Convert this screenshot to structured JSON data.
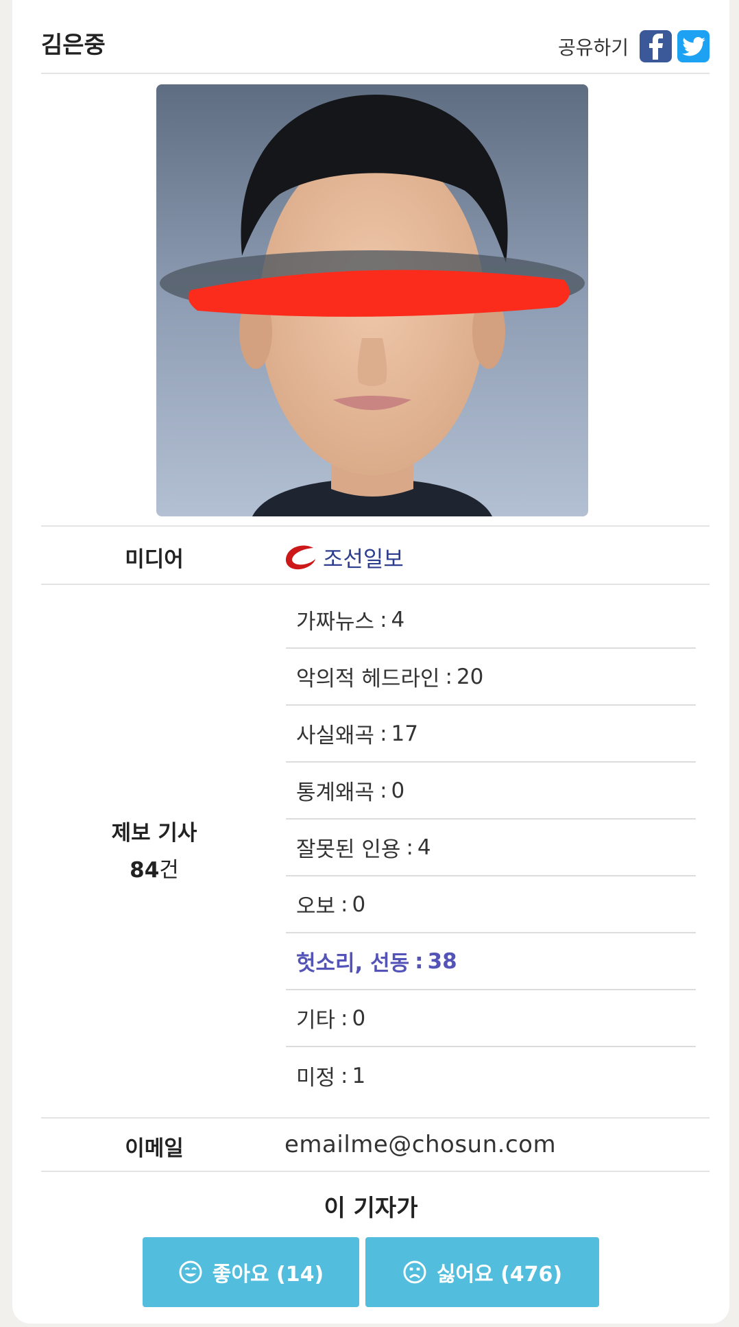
{
  "reporter": {
    "name": "김은중"
  },
  "share": {
    "label": "공유하기"
  },
  "media": {
    "label": "미디어",
    "name": "조선일보"
  },
  "reports": {
    "label": "제보 기사",
    "count": "84",
    "unit": "건",
    "items": [
      {
        "name": "가짜뉴스",
        "value": "4"
      },
      {
        "name": "악의적 헤드라인",
        "value": "20"
      },
      {
        "name": "사실왜곡",
        "value": "17"
      },
      {
        "name": "통계왜곡",
        "value": "0"
      },
      {
        "name": "잘못된 인용",
        "value": "4"
      },
      {
        "name": "오보",
        "value": "0"
      },
      {
        "name": "헛소리, 선동",
        "value": "38"
      },
      {
        "name": "기타",
        "value": "0"
      },
      {
        "name": "미정",
        "value": "1"
      }
    ]
  },
  "email": {
    "label": "이메일",
    "value": "emailme@chosun.com"
  },
  "vote": {
    "title": "이 기자가",
    "like_label": "좋아요 (14)",
    "dislike_label": "싫어요 (476)"
  },
  "colors": {
    "accent": "#52bddc",
    "media_link": "#2c3d8f",
    "highlight": "#5454b8",
    "facebook": "#3b5998",
    "twitter": "#1da1f2"
  },
  "icons": [
    "facebook-icon",
    "twitter-icon",
    "chosun-logo-icon",
    "smile-icon",
    "frown-icon"
  ]
}
